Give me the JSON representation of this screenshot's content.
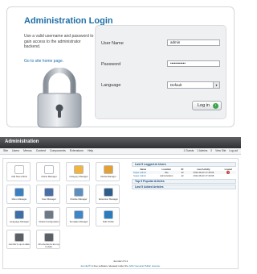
{
  "login": {
    "title": "Administration Login",
    "description": "Use a valid username and password to gain access to the administrator backend.",
    "home_link": "Go to site home page.",
    "username_label": "User Name",
    "username_value": "admin",
    "password_label": "Password",
    "password_value": "••••••••••••",
    "language_label": "Language",
    "language_value": "Default",
    "login_button": "Log in"
  },
  "admin": {
    "title": "Administration",
    "menu": [
      "Site",
      "Users",
      "Menus",
      "Content",
      "Components",
      "Extensions",
      "Help"
    ],
    "status": [
      "1 Guests",
      "1 Admins",
      "0",
      "View Site",
      "Log out"
    ],
    "icons": [
      {
        "label": "Add New Article",
        "color": "#ffffff",
        "icon": "add-article-icon"
      },
      {
        "label": "Article Manager",
        "color": "#ffffff",
        "icon": "article-manager-icon"
      },
      {
        "label": "Category Manager",
        "color": "#f2b43a",
        "icon": "category-manager-icon"
      },
      {
        "label": "Media Manager",
        "color": "#e5a032",
        "icon": "media-manager-icon"
      },
      {
        "label": "Menu Manager",
        "color": "#3a7fc1",
        "icon": "menu-manager-icon"
      },
      {
        "label": "User Manager",
        "color": "#4a6fa8",
        "icon": "user-manager-icon"
      },
      {
        "label": "Module Manager",
        "color": "#5c8fc0",
        "icon": "module-manager-icon"
      },
      {
        "label": "Extension Manager",
        "color": "#2f5e8c",
        "icon": "extension-manager-icon"
      },
      {
        "label": "Language Manager",
        "color": "#3d6ea8",
        "icon": "language-manager-icon"
      },
      {
        "label": "Global Configuration",
        "color": "#6d7a86",
        "icon": "global-config-icon"
      },
      {
        "label": "Template Manager",
        "color": "#3f86c7",
        "icon": "template-manager-icon"
      },
      {
        "label": "Edit Profile",
        "color": "#2a7cc0",
        "icon": "edit-profile-icon"
      },
      {
        "label": "Joomla! is up-to-date.",
        "color": "#5a6066",
        "icon": "joomla-update-icon"
      },
      {
        "label": "All extensions are up-to-date.",
        "color": "#5a6066",
        "icon": "extensions-update-icon"
      }
    ],
    "logged_in": {
      "heading": "Last 5 Logged-in Users",
      "columns": [
        "Name",
        "Location",
        "ID",
        "Last Activity",
        "Logout"
      ],
      "rows": [
        {
          "name": "Super Admin",
          "location": "Site",
          "id": "42",
          "activity": "2011-08-23 17:46:06"
        },
        {
          "name": "Super Admin",
          "location": "Administrator",
          "id": "42",
          "activity": "2011-08-23 17:46:08"
        }
      ]
    },
    "popular_heading": "Top 5 Popular Articles",
    "recent_heading": "Last 5 Added Articles",
    "version": "Joomla! 2.5.4",
    "license_prefix": "Joomla!®",
    "license_mid": " is free software released under the ",
    "license_link": "GNU General Public License."
  }
}
